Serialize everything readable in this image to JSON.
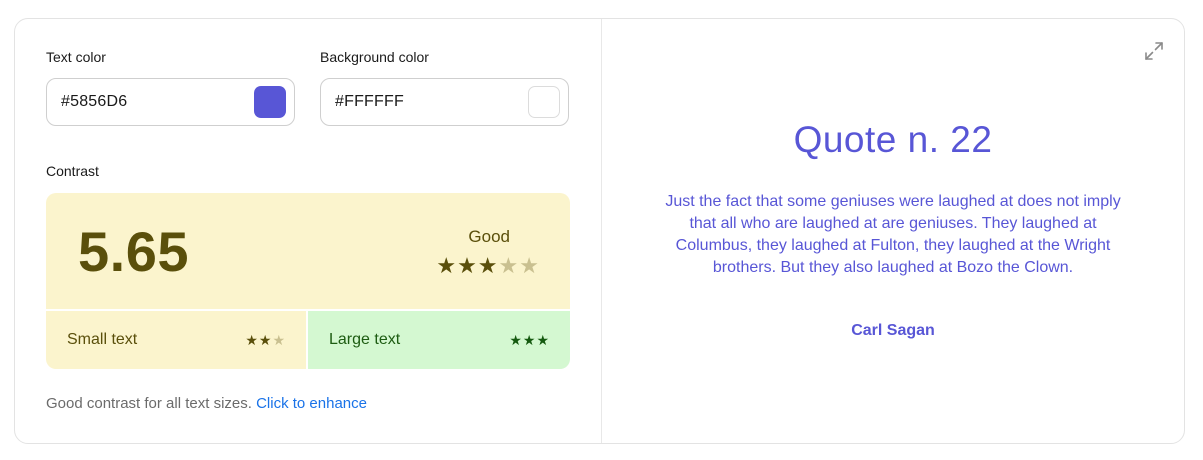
{
  "text_color": {
    "label": "Text color",
    "value": "#5856D6",
    "swatch": "#5856D6"
  },
  "background_color": {
    "label": "Background color",
    "value": "#FFFFFF",
    "swatch": "#FFFFFF"
  },
  "contrast": {
    "label": "Contrast",
    "score": "5.65",
    "rating": "Good",
    "rating_stars": 3,
    "max_stars": 5,
    "small_text": {
      "label": "Small text",
      "stars": 2,
      "max_stars": 3
    },
    "large_text": {
      "label": "Large text",
      "stars": 3,
      "max_stars": 3
    }
  },
  "footer": {
    "message": "Good contrast for all text sizes.",
    "link": "Click to enhance"
  },
  "preview": {
    "title": "Quote n. 22",
    "quote": "Just the fact that some geniuses were laughed at does not imply that all who are laughed at are geniuses. They laughed at Columbus, they laughed at Fulton, they laughed at the Wright brothers. But they also laughed at Bozo the Clown.",
    "author": "Carl Sagan",
    "expand_icon": "expand-icon"
  },
  "colors": {
    "accent": "#5856D6",
    "good_bg": "#FBF4CD",
    "good_fg": "#5A4F0B",
    "great_bg": "#D4F8D1",
    "great_fg": "#1D5C12",
    "link": "#1A73E8"
  }
}
